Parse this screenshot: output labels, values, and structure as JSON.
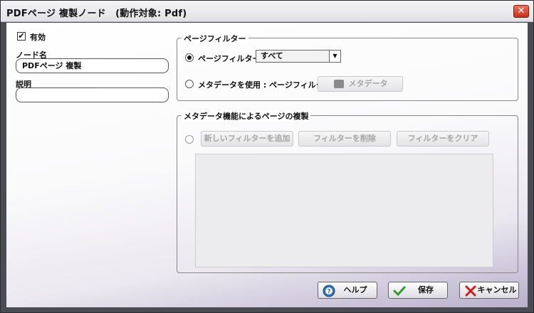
{
  "window": {
    "title": "PDFページ 複製ノード　(動作対象: Pdf)",
    "close_glyph": "✕"
  },
  "left": {
    "enabled_checked": true,
    "enabled_mark": "✔",
    "enabled_label": "有効",
    "node_name_label": "ノード名",
    "node_name_value": "PDFページ 複製",
    "description_label": "説明",
    "description_value": ""
  },
  "page_filter_group": {
    "title": "ページフィルター",
    "option_page_filter_label": "ページフィルター",
    "page_filter_selected": "すべて",
    "option_metadata_label": "メタデータを使用 : ページフィルター",
    "metadata_button_label": "メタデータ",
    "selected_option": "page_filter"
  },
  "metadata_group": {
    "title": "メタデータ機能によるページの複製",
    "add_filter_label": "新しいフィルターを追加",
    "delete_filter_label": "フィルターを削除",
    "clear_filter_label": "フィルターをクリア"
  },
  "footer": {
    "help_label": "ヘルプ",
    "save_label": "保存",
    "cancel_label": "キャンセル"
  },
  "colors": {
    "accent_help": "#2d6fb8",
    "accent_save": "#2f9a2f",
    "accent_cancel": "#cc1b1b",
    "close_button": "#c5301c"
  },
  "icons": {
    "help": "help-icon",
    "save": "checkmark-icon",
    "cancel": "x-icon",
    "metadata": "metadata-icon",
    "dropdown": "chevron-down-icon"
  }
}
